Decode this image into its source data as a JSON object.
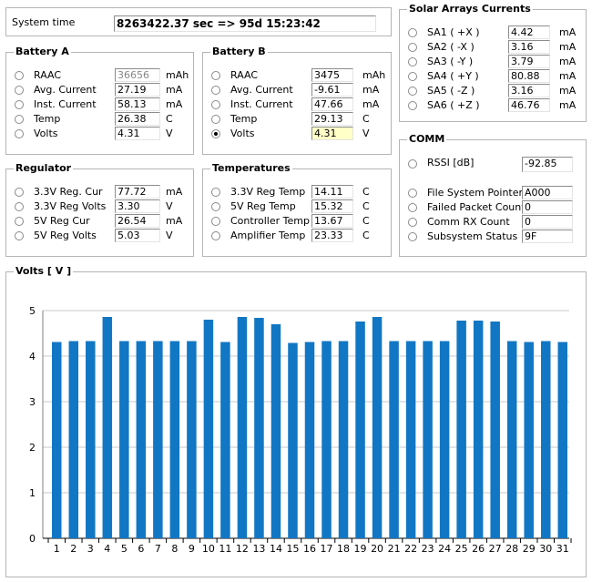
{
  "system_time": {
    "label": "System time",
    "value": "8263422.37 sec  => 95d 15:23:42"
  },
  "battery_a": {
    "title": "Battery A",
    "rows": [
      {
        "label": "RAAC",
        "value": "36656",
        "unit": "mAh",
        "checked": false,
        "style": "gray"
      },
      {
        "label": "Avg. Current",
        "value": "27.19",
        "unit": "mA",
        "checked": false,
        "style": ""
      },
      {
        "label": "Inst. Current",
        "value": "58.13",
        "unit": "mA",
        "checked": false,
        "style": ""
      },
      {
        "label": "Temp",
        "value": "26.38",
        "unit": "C",
        "checked": false,
        "style": ""
      },
      {
        "label": "Volts",
        "value": "4.31",
        "unit": "V",
        "checked": false,
        "style": ""
      }
    ]
  },
  "battery_b": {
    "title": "Battery B",
    "rows": [
      {
        "label": "RAAC",
        "value": "3475",
        "unit": "mAh",
        "checked": false,
        "style": ""
      },
      {
        "label": "Avg. Current",
        "value": "-9.61",
        "unit": "mA",
        "checked": false,
        "style": ""
      },
      {
        "label": "Inst. Current",
        "value": "47.66",
        "unit": "mA",
        "checked": false,
        "style": ""
      },
      {
        "label": "Temp",
        "value": "29.13",
        "unit": "C",
        "checked": false,
        "style": ""
      },
      {
        "label": "Volts",
        "value": "4.31",
        "unit": "V",
        "checked": true,
        "style": "hl"
      }
    ]
  },
  "regulator": {
    "title": "Regulator",
    "rows": [
      {
        "label": "3.3V Reg. Cur",
        "value": "77.72",
        "unit": "mA",
        "checked": false
      },
      {
        "label": "3.3V Reg Volts",
        "value": "3.30",
        "unit": "V",
        "checked": false
      },
      {
        "label": "5V Reg Cur",
        "value": "26.54",
        "unit": "mA",
        "checked": false
      },
      {
        "label": "5V Reg Volts",
        "value": "5.03",
        "unit": "V",
        "checked": false
      }
    ]
  },
  "temperatures": {
    "title": "Temperatures",
    "rows": [
      {
        "label": "3.3V Reg Temp",
        "value": "14.11",
        "unit": "C",
        "checked": false
      },
      {
        "label": "5V Reg Temp",
        "value": "15.32",
        "unit": "C",
        "checked": false
      },
      {
        "label": "Controller Temp",
        "value": "13.67",
        "unit": "C",
        "checked": false
      },
      {
        "label": "Amplifier Temp",
        "value": "23.33",
        "unit": "C",
        "checked": false
      }
    ]
  },
  "solar": {
    "title": "Solar Arrays Currents",
    "rows": [
      {
        "label": "SA1 ( +X )",
        "value": "4.42",
        "unit": "mA",
        "checked": false
      },
      {
        "label": "SA2 ( -X )",
        "value": "3.16",
        "unit": "mA",
        "checked": false
      },
      {
        "label": "SA3 ( -Y )",
        "value": "3.79",
        "unit": "mA",
        "checked": false
      },
      {
        "label": "SA4 ( +Y )",
        "value": "80.88",
        "unit": "mA",
        "checked": false
      },
      {
        "label": "SA5 ( -Z )",
        "value": "3.16",
        "unit": "mA",
        "checked": false
      },
      {
        "label": "SA6 ( +Z )",
        "value": "46.76",
        "unit": "mA",
        "checked": false
      }
    ]
  },
  "comm": {
    "title": "COMM",
    "rssi": {
      "label": "RSSI [dB]",
      "value": "-92.85",
      "checked": false
    },
    "rows": [
      {
        "label": "File System Pointer",
        "value": "A000",
        "checked": false
      },
      {
        "label": "Failed Packet Count",
        "value": "0",
        "checked": false
      },
      {
        "label": "Comm RX Count",
        "value": "0",
        "checked": false
      },
      {
        "label": "Subsystem Status",
        "value": "9F",
        "checked": false
      }
    ]
  },
  "volts_chart": {
    "title": "Volts  [ V ]",
    "chart_data": {
      "type": "bar",
      "title": "Volts  [ V ]",
      "categories": [
        "1",
        "2",
        "3",
        "4",
        "5",
        "6",
        "7",
        "8",
        "9",
        "10",
        "11",
        "12",
        "13",
        "14",
        "15",
        "16",
        "17",
        "18",
        "19",
        "20",
        "21",
        "22",
        "23",
        "24",
        "25",
        "26",
        "27",
        "28",
        "29",
        "30",
        "31"
      ],
      "values": [
        4.31,
        4.33,
        4.33,
        4.86,
        4.33,
        4.33,
        4.33,
        4.33,
        4.33,
        4.8,
        4.31,
        4.86,
        4.84,
        4.7,
        4.29,
        4.31,
        4.33,
        4.33,
        4.76,
        4.86,
        4.33,
        4.33,
        4.33,
        4.33,
        4.78,
        4.78,
        4.76,
        4.33,
        4.31,
        4.33,
        4.31
      ],
      "yticks": [
        "0",
        "1",
        "2",
        "3",
        "4",
        "5"
      ],
      "ylim": [
        0,
        5
      ],
      "grid": true,
      "bar_color": "#1177c4"
    }
  }
}
